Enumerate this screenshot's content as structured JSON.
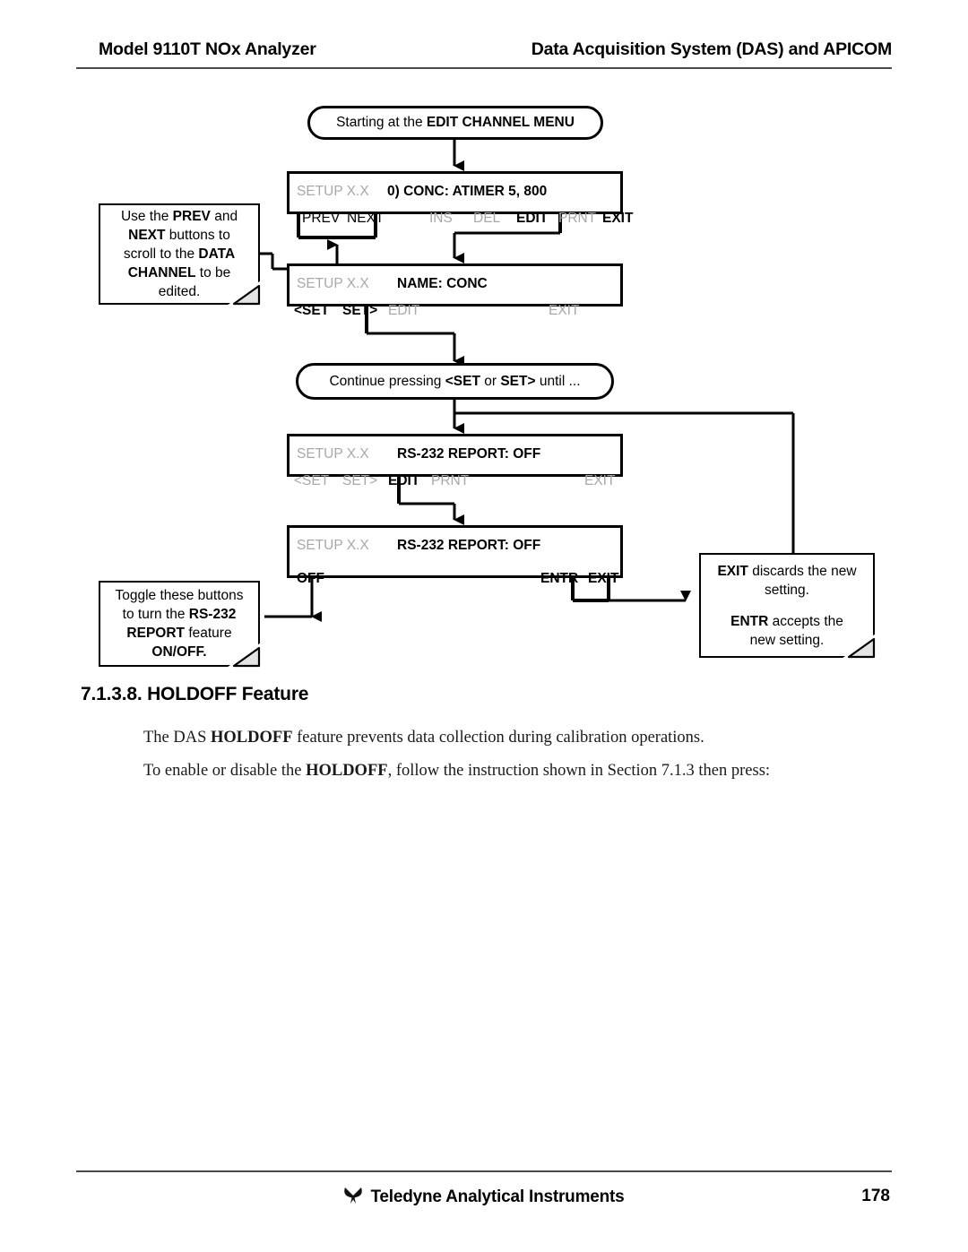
{
  "header": {
    "left_title": "Model 9110T NOx Analyzer",
    "right_title": "Data Acquisition System (DAS) and APICOM"
  },
  "flowchart": {
    "start_pill": {
      "prefix": "Starting at the ",
      "emphasis": "EDIT CHANNEL MENU"
    },
    "display_1": {
      "setup_label": "SETUP X.X",
      "line1": "0) CONC:  ATIMER 5, 800",
      "buttons": [
        {
          "label": "PREV",
          "state": "plain"
        },
        {
          "label": "NEXT",
          "state": "plain"
        },
        {
          "label": "INS",
          "state": "dim"
        },
        {
          "label": "DEL",
          "state": "dim"
        },
        {
          "label": "EDIT",
          "state": "lit"
        },
        {
          "label": "PRNT",
          "state": "dim"
        },
        {
          "label": "EXIT",
          "state": "lit"
        }
      ]
    },
    "note_prev_next": {
      "line1_a": "Use the ",
      "line1_b": "PREV",
      "line1_c": " and",
      "line2_a": "NEXT",
      "line2_b": " buttons to",
      "line3_a": "scroll to the ",
      "line3_b": "DATA",
      "line4_a": "CHANNEL",
      "line4_b": " to be",
      "line5": "edited."
    },
    "display_2": {
      "setup_label": "SETUP X.X",
      "line1": "NAME: CONC",
      "buttons": [
        {
          "label": "<SET",
          "state": "lit"
        },
        {
          "label": "SET>",
          "state": "lit"
        },
        {
          "label": "EDIT",
          "state": "dim"
        },
        {
          "label": "EXIT",
          "state": "dim"
        }
      ]
    },
    "continue_pill": {
      "part1": "Continue pressing ",
      "emphasis1": "<SET",
      "part2": " or ",
      "emphasis2": "SET>",
      "part3": " until ..."
    },
    "display_3": {
      "setup_label": "SETUP X.X",
      "line1": "RS-232 REPORT: OFF",
      "buttons": [
        {
          "label": "<SET",
          "state": "dim"
        },
        {
          "label": "SET>",
          "state": "dim"
        },
        {
          "label": "EDIT",
          "state": "lit"
        },
        {
          "label": "PRNT",
          "state": "dim"
        },
        {
          "label": "EXIT",
          "state": "dim"
        }
      ]
    },
    "display_4": {
      "setup_label": "SETUP X.X",
      "line1": "RS-232 REPORT: OFF",
      "buttons": [
        {
          "label": "OFF",
          "state": "lit"
        },
        {
          "label": "ENTR",
          "state": "lit"
        },
        {
          "label": "EXIT",
          "state": "lit"
        }
      ]
    },
    "note_toggle": {
      "line1": "Toggle these buttons",
      "line2_a": "to turn the ",
      "line2_b": "RS-232",
      "line3_a": "REPORT",
      "line3_b": " feature",
      "line4": "ON/OFF."
    },
    "note_exit_entr": {
      "line1_a": "EXIT",
      "line1_b": " discards the new",
      "line2": "setting.",
      "line3_a": "ENTR",
      "line3_b": " accepts the",
      "line4": "new setting."
    }
  },
  "section": {
    "heading": "7.1.3.8. HOLDOFF Feature",
    "paragraph_1_a": "The DAS ",
    "paragraph_1_b": "HOLDOFF",
    "paragraph_1_c": " feature prevents data collection during calibration operations.",
    "paragraph_2_a": "To enable or disable the ",
    "paragraph_2_b": "HOLDOFF",
    "paragraph_2_c": ", follow the instruction shown in Section 7.1.3 then press:"
  },
  "footer": {
    "company": "Teledyne Analytical Instruments",
    "page_number": "178"
  }
}
